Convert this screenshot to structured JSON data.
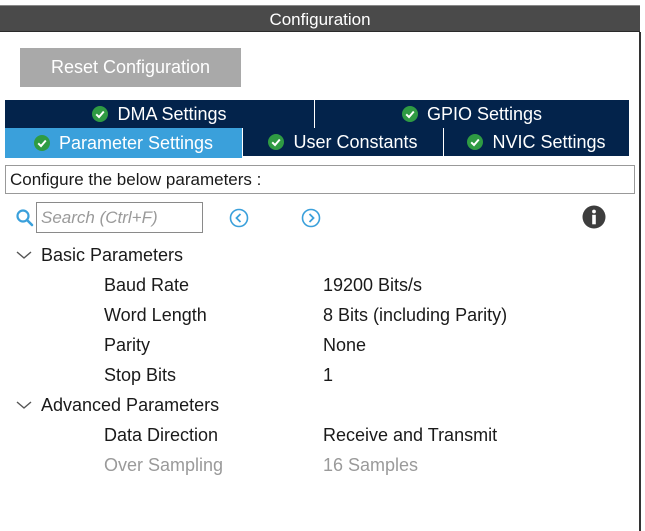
{
  "window": {
    "title": "Configuration"
  },
  "toolbar": {
    "reset_label": "Reset Configuration"
  },
  "tabs": [
    {
      "label": "DMA Settings",
      "active": false
    },
    {
      "label": "GPIO Settings",
      "active": false
    },
    {
      "label": "Parameter Settings",
      "active": true
    },
    {
      "label": "User Constants",
      "active": false
    },
    {
      "label": "NVIC Settings",
      "active": false
    }
  ],
  "description": "Configure the below parameters :",
  "search": {
    "placeholder": "Search (Ctrl+F)",
    "value": ""
  },
  "groups": [
    {
      "label": "Basic Parameters",
      "expanded": true,
      "params": [
        {
          "name": "Baud Rate",
          "value": "19200 Bits/s",
          "enabled": true
        },
        {
          "name": "Word Length",
          "value": "8 Bits (including Parity)",
          "enabled": true
        },
        {
          "name": "Parity",
          "value": "None",
          "enabled": true
        },
        {
          "name": "Stop Bits",
          "value": "1",
          "enabled": true
        }
      ]
    },
    {
      "label": "Advanced Parameters",
      "expanded": true,
      "params": [
        {
          "name": "Data Direction",
          "value": "Receive and Transmit",
          "enabled": true
        },
        {
          "name": "Over Sampling",
          "value": "16 Samples",
          "enabled": false
        }
      ]
    }
  ],
  "colors": {
    "tab_bg": "#03234b",
    "tab_active_bg": "#3aa0db",
    "check_green": "#2f9b43",
    "titlebar_bg": "#4a4a4a",
    "reset_bg": "#a9a9a9",
    "nav_blue": "#3aa0db",
    "disabled_text": "#9a9a9a"
  },
  "icons": {
    "tab_check": "check-circle-icon",
    "search": "search-icon",
    "prev": "chevron-left-circle-icon",
    "next": "chevron-right-circle-icon",
    "info": "info-icon",
    "group_toggle": "chevron-down-icon"
  }
}
